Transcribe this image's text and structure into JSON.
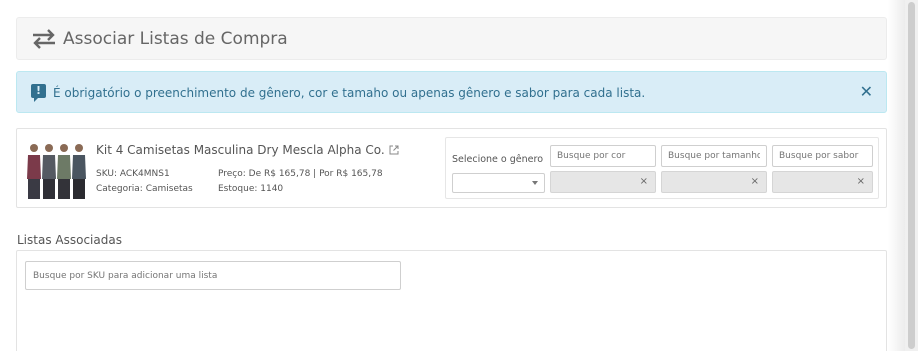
{
  "header": {
    "title": "Associar Listas de Compra",
    "icon": "transfer-arrows-icon"
  },
  "alert": {
    "icon": "alert-flag-icon",
    "text": "É obrigatório o preenchimento de gênero, cor e tamaho ou apenas gênero e sabor para cada lista.",
    "close_label": "✕",
    "color": "#31708f",
    "background": "#d9edf7"
  },
  "product": {
    "name": "Kit 4 Camisetas Masculina Dry Mescla Alpha Co.",
    "sku": "SKU: ACK4MNS1",
    "category": "Categoria: Camisetas",
    "price": "Preço: De R$ 165,78 | Por R$ 165,78",
    "stock": "Estoque: 1140",
    "image_icon": "product-tshirts-image"
  },
  "filters": {
    "genero_label": "Selecione o gênero",
    "genero_value": "",
    "cor_placeholder": "Busque por cor",
    "tamanho_placeholder": "Busque por tamanho",
    "sabor_placeholder": "Busque por sabor",
    "clear_label": "×"
  },
  "associated": {
    "title": "Listas Associadas",
    "search_placeholder": "Busque por SKU para adicionar uma lista"
  }
}
